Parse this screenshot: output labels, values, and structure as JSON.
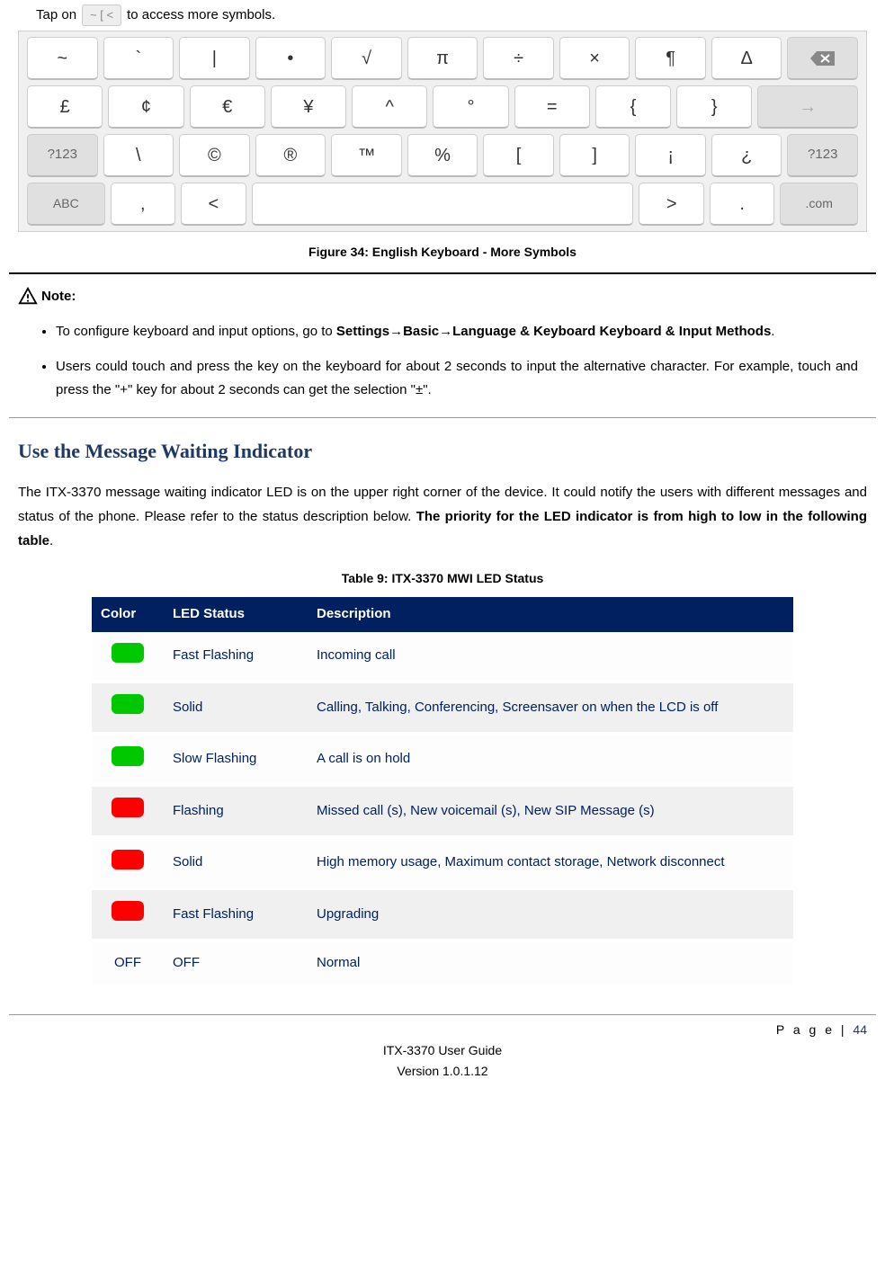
{
  "intro": {
    "tap_before": "Tap on",
    "tap_key": "~ [ <",
    "tap_after": "to access more symbols."
  },
  "keyboard": {
    "row1": [
      "~",
      "`",
      "|",
      "•",
      "√",
      "π",
      "÷",
      "×",
      "¶",
      "Δ"
    ],
    "row1_end": "⌫",
    "row2": [
      "£",
      "¢",
      "€",
      "¥",
      "^",
      "°",
      "=",
      "{",
      "}"
    ],
    "row2_end": "→",
    "row3_start": "?123",
    "row3": [
      "\\",
      "©",
      "®",
      "™",
      "%",
      "[",
      "]",
      "¡",
      "¿"
    ],
    "row3_end": "?123",
    "row4_start": "ABC",
    "row4_a": ",",
    "row4_b": "<",
    "row4_c": ">",
    "row4_d": ".",
    "row4_end": ".com"
  },
  "figure_caption": "Figure 34: English Keyboard - More Symbols",
  "note_label": "Note:",
  "notes": {
    "item1_a": "To configure keyboard and input options, go to ",
    "item1_b": "Settings→Basic→Language & Keyboard Keyboard & Input Methods",
    "item1_c": ".",
    "item2": "Users could touch and press the key on the keyboard for about 2 seconds to input the alternative character. For example, touch and press the \"+\" key for about 2 seconds can get the selection \"±\"."
  },
  "section_heading": "Use the Message Waiting Indicator",
  "section_body_a": "The ITX-3370 message waiting indicator LED is on the upper right corner of the device. It could notify the users with different messages and status of the phone. Please refer to the status description below. ",
  "section_body_b": "The priority for the LED indicator is from high to low in the following table",
  "section_body_c": ".",
  "table_caption": "Table 9: ITX-3370 MWI LED Status",
  "table": {
    "headers": [
      "Color",
      "LED Status",
      "Description"
    ],
    "rows": [
      {
        "color": "green",
        "color_text": "",
        "status": "Fast Flashing",
        "desc": "Incoming call"
      },
      {
        "color": "green",
        "color_text": "",
        "status": "Solid",
        "desc": "Calling, Talking, Conferencing, Screensaver on when the LCD is off"
      },
      {
        "color": "green",
        "color_text": "",
        "status": "Slow Flashing",
        "desc": "A call is on hold"
      },
      {
        "color": "red",
        "color_text": "",
        "status": "Flashing",
        "desc": "Missed call (s), New voicemail (s), New SIP Message (s)"
      },
      {
        "color": "red",
        "color_text": "",
        "status": "Solid",
        "desc": "High memory usage, Maximum contact storage, Network disconnect"
      },
      {
        "color": "red",
        "color_text": "",
        "status": "Fast Flashing",
        "desc": "Upgrading"
      },
      {
        "color": "off",
        "color_text": "OFF",
        "status": "OFF",
        "desc": "Normal"
      }
    ]
  },
  "footer": {
    "page_label": "P a g e | ",
    "page_num": "44",
    "line1": "ITX-3370 User Guide",
    "line2": "Version 1.0.1.12"
  }
}
